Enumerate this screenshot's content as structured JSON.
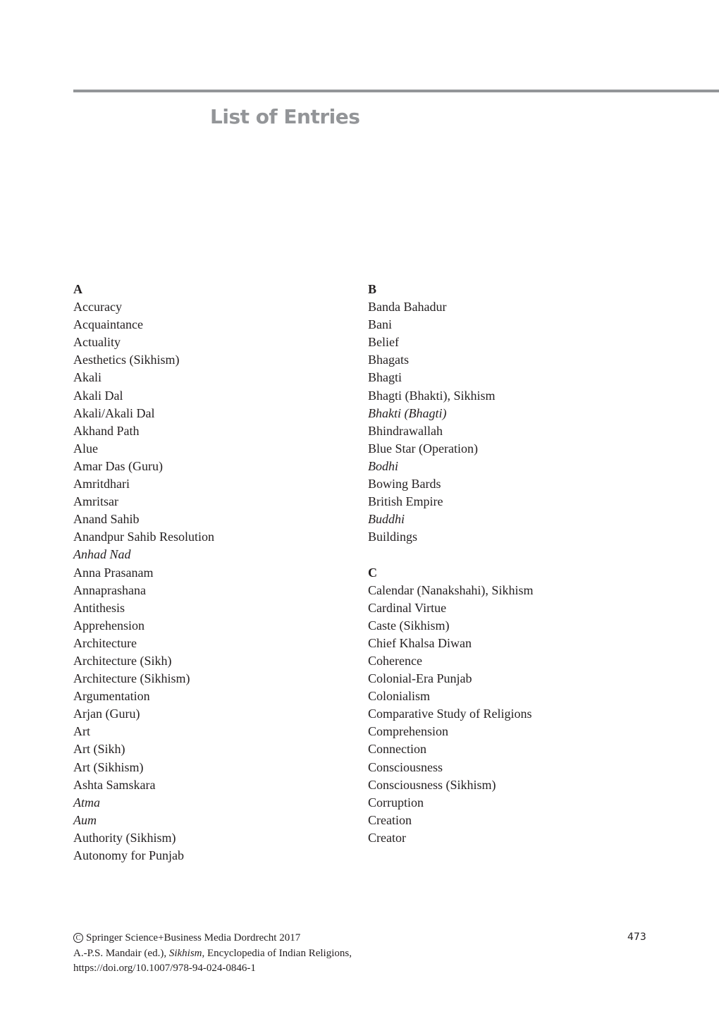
{
  "page": {
    "title": "List of Entries",
    "page_number": "473"
  },
  "columns": [
    {
      "sections": [
        {
          "letter": "A",
          "entries": [
            {
              "text": "Accuracy",
              "italic": false
            },
            {
              "text": "Acquaintance",
              "italic": false
            },
            {
              "text": "Actuality",
              "italic": false
            },
            {
              "text": "Aesthetics (Sikhism)",
              "italic": false
            },
            {
              "text": "Akali",
              "italic": false
            },
            {
              "text": "Akali Dal",
              "italic": false
            },
            {
              "text": "Akali/Akali Dal",
              "italic": false
            },
            {
              "text": "Akhand Path",
              "italic": false
            },
            {
              "text": "Alue",
              "italic": false
            },
            {
              "text": "Amar Das (Guru)",
              "italic": false
            },
            {
              "text": "Amritdhari",
              "italic": false
            },
            {
              "text": "Amritsar",
              "italic": false
            },
            {
              "text": "Anand Sahib",
              "italic": false
            },
            {
              "text": "Anandpur Sahib Resolution",
              "italic": false
            },
            {
              "text": "Anhad Nad",
              "italic": true
            },
            {
              "text": "Anna Prasanam",
              "italic": false
            },
            {
              "text": "Annaprashana",
              "italic": false
            },
            {
              "text": "Antithesis",
              "italic": false
            },
            {
              "text": "Apprehension",
              "italic": false
            },
            {
              "text": "Architecture",
              "italic": false
            },
            {
              "text": "Architecture (Sikh)",
              "italic": false
            },
            {
              "text": "Architecture (Sikhism)",
              "italic": false
            },
            {
              "text": "Argumentation",
              "italic": false
            },
            {
              "text": "Arjan (Guru)",
              "italic": false
            },
            {
              "text": "Art",
              "italic": false
            },
            {
              "text": "Art (Sikh)",
              "italic": false
            },
            {
              "text": "Art (Sikhism)",
              "italic": false
            },
            {
              "text": "Ashta Samskara",
              "italic": false
            },
            {
              "text": "Atma",
              "italic": true
            },
            {
              "text": "Aum",
              "italic": true
            },
            {
              "text": "Authority (Sikhism)",
              "italic": false
            },
            {
              "text": "Autonomy for Punjab",
              "italic": false
            }
          ]
        }
      ]
    },
    {
      "sections": [
        {
          "letter": "B",
          "entries": [
            {
              "text": "Banda Bahadur",
              "italic": false
            },
            {
              "text": "Bani",
              "italic": false
            },
            {
              "text": "Belief",
              "italic": false
            },
            {
              "text": "Bhagats",
              "italic": false
            },
            {
              "text": "Bhagti",
              "italic": false
            },
            {
              "text": "Bhagti (Bhakti), Sikhism",
              "italic": false
            },
            {
              "text": "Bhakti (Bhagti)",
              "italic": true
            },
            {
              "text": "Bhindrawallah",
              "italic": false
            },
            {
              "text": "Blue Star (Operation)",
              "italic": false
            },
            {
              "text": "Bodhi",
              "italic": true
            },
            {
              "text": "Bowing Bards",
              "italic": false
            },
            {
              "text": "British Empire",
              "italic": false
            },
            {
              "text": "Buddhi",
              "italic": true
            },
            {
              "text": "Buildings",
              "italic": false
            }
          ]
        },
        {
          "letter": "C",
          "entries": [
            {
              "text": "Calendar (Nanakshahi), Sikhism",
              "italic": false
            },
            {
              "text": "Cardinal Virtue",
              "italic": false
            },
            {
              "text": "Caste (Sikhism)",
              "italic": false
            },
            {
              "text": "Chief Khalsa Diwan",
              "italic": false
            },
            {
              "text": "Coherence",
              "italic": false
            },
            {
              "text": "Colonial-Era Punjab",
              "italic": false
            },
            {
              "text": "Colonialism",
              "italic": false
            },
            {
              "text": "Comparative Study of Religions",
              "italic": false
            },
            {
              "text": "Comprehension",
              "italic": false
            },
            {
              "text": "Connection",
              "italic": false
            },
            {
              "text": "Consciousness",
              "italic": false
            },
            {
              "text": "Consciousness (Sikhism)",
              "italic": false
            },
            {
              "text": "Corruption",
              "italic": false
            },
            {
              "text": "Creation",
              "italic": false
            },
            {
              "text": "Creator",
              "italic": false
            }
          ]
        }
      ]
    }
  ],
  "footer": {
    "copyright_symbol": "C",
    "copyright": "Springer Science+Business Media Dordrecht 2017",
    "citation_prefix": "A.-P.S. Mandair (ed.), ",
    "citation_title": "Sikhism",
    "citation_suffix": ", Encyclopedia of Indian Religions,",
    "doi": "https://doi.org/10.1007/978-94-024-0846-1"
  }
}
